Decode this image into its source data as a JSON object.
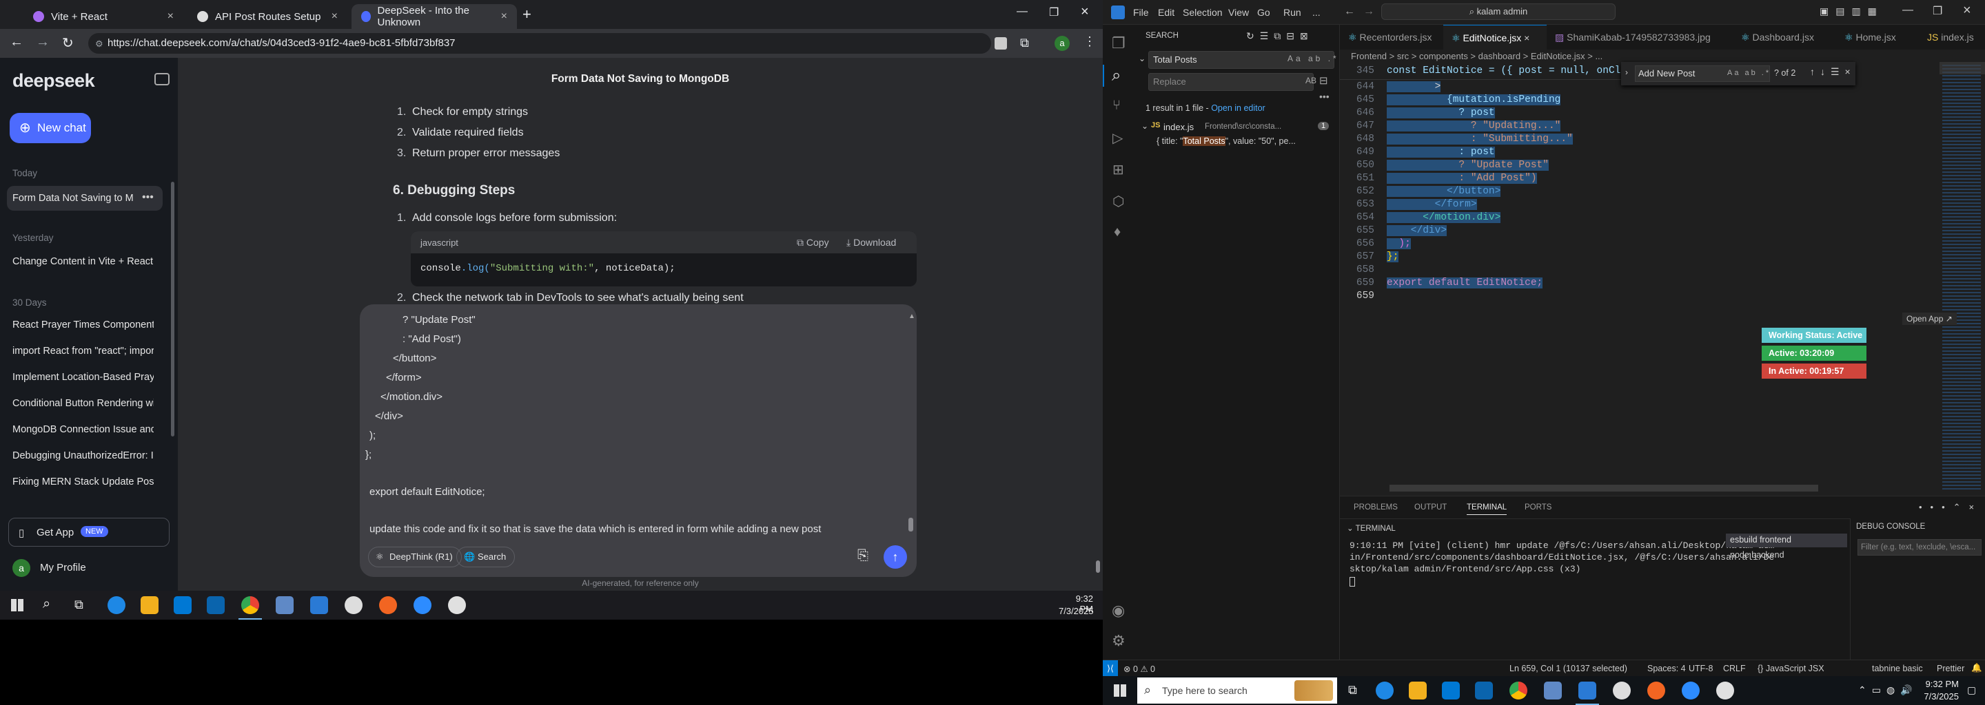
{
  "browser": {
    "tabs": [
      {
        "label": "Vite + React",
        "close": "×"
      },
      {
        "label": "API Post Routes Setup",
        "close": "×"
      },
      {
        "label": "DeepSeek - Into the Unknown",
        "close": "×"
      }
    ],
    "new_tab": "+",
    "url": "https://chat.deepseek.com/a/chat/s/04d3ced3-91f2-4ae9-bc81-5fbfd73bf837"
  },
  "deepseek": {
    "logo": "deepseek",
    "new_chat": "New chat",
    "sections": {
      "today": "Today",
      "yesterday": "Yesterday",
      "days30": "30 Days"
    },
    "history": [
      "Form Data Not Saving to M",
      "Change Content in Vite + React",
      "React Prayer Times Component",
      "import React from \"react\"; impor",
      "Implement Location-Based Praye",
      "Conditional Button Rendering wi",
      "MongoDB Connection Issue and",
      "Debugging UnauthorizedError: I",
      "Fixing MERN Stack Update Post"
    ],
    "get_app": "Get App",
    "new_badge": "NEW",
    "avatar": "a",
    "profile": "My Profile",
    "chat_title": "Form Data Not Saving to MongoDB",
    "list1": [
      "Check for empty strings",
      "Validate required fields",
      "Return proper error messages"
    ],
    "heading": "6. Debugging Steps",
    "step1": "Add console logs before form submission:",
    "code_lang": "javascript",
    "copy": "Copy",
    "download": "Download",
    "code_fn": "console",
    "code_method": ".log(",
    "code_str": "\"Submitting with:\"",
    "code_rest": ", noticeData);",
    "step2": "Check the network tab in DevTools to see what's actually being sent",
    "input_lines": [
      "? \"Update Post\"",
      ": \"Add Post\")",
      "</button>",
      "</form>",
      "</motion.div>",
      "</div>",
      ");",
      "};",
      "",
      "export default EditNotice;",
      "",
      "update this code and fix it so that is save the data which is entered in form while adding a new post"
    ],
    "deepthink": "DeepThink (R1)",
    "search": "Search",
    "footer": "AI-generated, for reference only"
  },
  "taskbar_left": {
    "time": "9:32 PM",
    "date": "7/3/2025"
  },
  "vscode": {
    "menu": [
      "File",
      "Edit",
      "Selection",
      "View",
      "Go",
      "Run",
      "..."
    ],
    "command_center": "kalam admin",
    "search_title": "SEARCH",
    "search_value": "Total Posts",
    "replace_placeholder": "Replace",
    "results_summary": "1 result in 1 file - ",
    "open_in_editor": "Open in editor",
    "result_file": "index.js",
    "result_path": "Frontend\\src\\consta...",
    "result_count": "1",
    "result_pre": "{ title: \"",
    "result_match": "Total Posts",
    "result_post": "\", value: \"50\", pe...",
    "editor_tabs": [
      "Recentorders.jsx",
      "EditNotice.jsx",
      "ShamiKabab-1749582733983.jpg",
      "Dashboard.jsx",
      "Home.jsx",
      "index.js"
    ],
    "breadcrumb": "Frontend > src > components > dashboard > EditNotice.jsx > ...",
    "sticky": "const EditNotice = ({ post = null, onClose }) =>",
    "find_value": "Add New Post",
    "find_count": "? of 2",
    "code_lines": [
      {
        "n": "645",
        "t": "          {mutation.isPending"
      },
      {
        "n": "646",
        "t": "            ? post"
      },
      {
        "n": "647",
        "t": "              ? \"Updating...\""
      },
      {
        "n": "648",
        "t": "              : \"Submitting...\""
      },
      {
        "n": "649",
        "t": "            : post"
      },
      {
        "n": "650",
        "t": "            ? \"Update Post\""
      },
      {
        "n": "651",
        "t": "            : \"Add Post\")"
      },
      {
        "n": "652",
        "t": "          </button>"
      },
      {
        "n": "653",
        "t": "        </form>"
      },
      {
        "n": "654",
        "t": "      </motion.div>"
      },
      {
        "n": "655",
        "t": "    </div>"
      },
      {
        "n": "656",
        "t": "  );"
      },
      {
        "n": "657",
        "t": "};"
      },
      {
        "n": "658",
        "t": ""
      },
      {
        "n": "659",
        "t": "export default EditNotice;"
      }
    ],
    "open_app": "Open App ↗",
    "working_status": "Working Status: Active",
    "active": "Active: 03:20:09",
    "inactive": "In Active: 00:19:57",
    "panel_tabs": [
      "PROBLEMS",
      "OUTPUT",
      "TERMINAL",
      "PORTS"
    ],
    "terminal_label": "TERMINAL",
    "terminal_lines": [
      "9:10:11 PM [vite] (client) hmr update /@fs/C:/Users/ahsan.ali/Desktop/kalam adm",
      "in/Frontend/src/components/dashboard/EditNotice.jsx, /@fs/C:/Users/ahsan.ali/De",
      "sktop/kalam admin/Frontend/src/App.css (x3)"
    ],
    "terminals": [
      "esbuild frontend",
      "node backend"
    ],
    "debug_console": "DEBUG CONSOLE",
    "debug_filter": "Filter (e.g. text, !exclude, \\esca...",
    "status_left": "⊗ 0  ⚠ 0",
    "status_items": [
      "Ln 659, Col 1 (10137 selected)",
      "Spaces: 4",
      "UTF-8",
      "CRLF",
      "{} JavaScript JSX",
      "tabnine basic",
      "Prettier"
    ],
    "search_taskbar": "Type here to search",
    "time": "9:32 PM",
    "date": "7/3/2025"
  }
}
